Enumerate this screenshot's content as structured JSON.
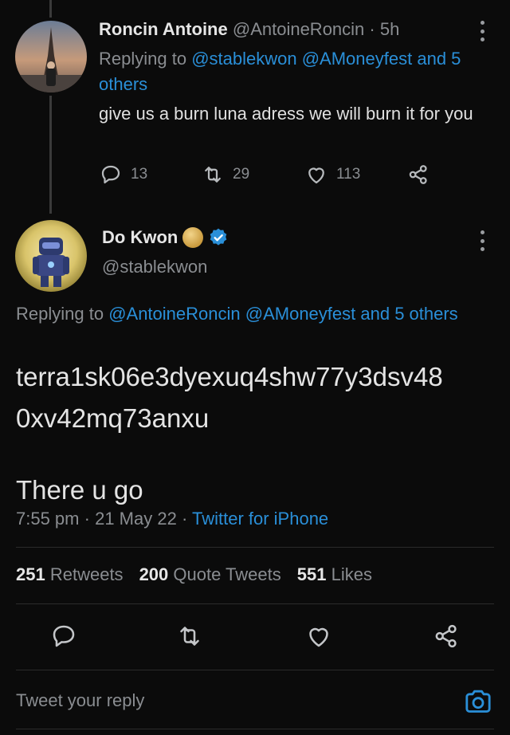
{
  "colors": {
    "background": "#0b0b0b",
    "link": "#2a8fd8",
    "muted": "#8a8d91",
    "verified": "#2a8fd8"
  },
  "reply_tweet": {
    "name": "Roncin Antoine",
    "handle": "@AntoineRoncin",
    "dot": "·",
    "time": "5h",
    "replying_prefix": "Replying to ",
    "mention1": "@stablekwon",
    "mention2": "@AMoneyfest",
    "and_others": "and 5 others",
    "body": "give us a burn luna adress we will burn it for you",
    "actions": {
      "reply_count": "13",
      "retweet_count": "29",
      "like_count": "113"
    },
    "icons": [
      "more-vertical-icon",
      "reply-icon",
      "retweet-icon",
      "like-icon",
      "share-icon"
    ]
  },
  "main_tweet": {
    "name": "Do Kwon",
    "handle": "@stablekwon",
    "replying_prefix": "Replying to ",
    "mention1": "@AntoineRoncin",
    "mention2": "@AMoneyfest",
    "and_others": "and 5 others",
    "body_line1": "terra1sk06e3dyexuq4shw77y3dsv48",
    "body_line2": "0xv42mq73anxu",
    "body_line3": "There u go",
    "time": "7:55 pm",
    "date": "21 May 22",
    "source": "Twitter for iPhone",
    "separator": "·",
    "stats": {
      "retweets_count": "251",
      "retweets_label": "Retweets",
      "quotes_count": "200",
      "quotes_label": "Quote Tweets",
      "likes_count": "551",
      "likes_label": "Likes"
    }
  },
  "composer": {
    "placeholder": "Tweet your reply"
  }
}
